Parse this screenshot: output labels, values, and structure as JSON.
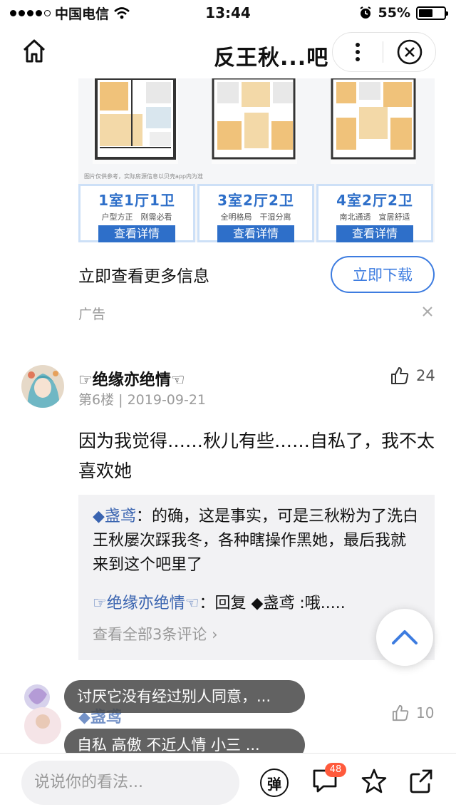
{
  "status_bar": {
    "carrier": "中国电信",
    "time": "13:44",
    "battery": "55%",
    "battery_level": 0.55
  },
  "nav": {
    "title": "反王秋...吧 ›"
  },
  "ad": {
    "note": "图片仅供参考，实际房源信息以贝壳app内为准",
    "cards": [
      {
        "room": "1室1厅1卫",
        "feature": "户型方正　刚需必看",
        "button": "查看详情"
      },
      {
        "room": "3室2厅2卫",
        "feature": "全明格局　干湿分离",
        "button": "查看详情"
      },
      {
        "room": "4室2厅2卫",
        "feature": "南北通透　宜居舒适",
        "button": "查看详情"
      }
    ],
    "cta_text": "立即查看更多信息",
    "download_label": "立即下载",
    "tag": "广告"
  },
  "post": {
    "user_name": "☞绝缘亦绝情☜",
    "floor": "第6楼",
    "date": "2019-09-21",
    "likes": "24",
    "content": "因为我觉得……秋儿有些……自私了，我不太喜欢她",
    "reply1_name": "◆盏鸢",
    "reply1_text": "的确，这是事实，可是三秋粉为了洗白王秋屡次踩我冬，各种瞎操作黑她，最后我就来到这个吧里了",
    "reply2_name": "☞绝缘亦绝情☜",
    "reply2_text": "回复 ◆盏鸢 :哦.....",
    "view_all": "查看全部3条评论"
  },
  "post2": {
    "user_name": "◆盏鸢",
    "likes": "10"
  },
  "danmaku": [
    "讨厌它没有经过别人同意，...",
    "自私 高傲 不近人情 小三 ..."
  ],
  "bottom_bar": {
    "placeholder": "说说你的看法...",
    "danmaku_label": "弹",
    "comment_count": "48"
  }
}
